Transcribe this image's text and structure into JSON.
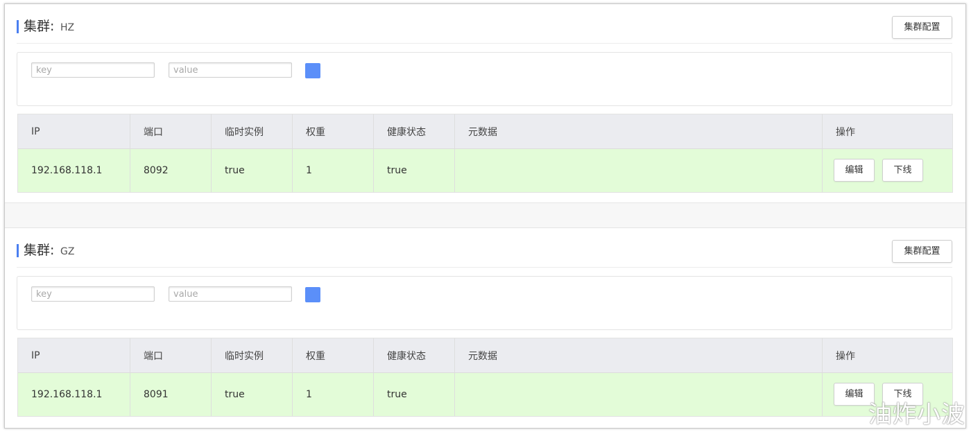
{
  "clusters": [
    {
      "title_label": "集群:",
      "name": "HZ",
      "config_button": "集群配置",
      "filter": {
        "key_placeholder": "key",
        "value_placeholder": "value"
      },
      "columns": [
        "IP",
        "端口",
        "临时实例",
        "权重",
        "健康状态",
        "元数据",
        "操作"
      ],
      "rows": [
        {
          "ip": "192.168.118.1",
          "port": "8092",
          "ephemeral": "true",
          "weight": "1",
          "healthy": "true",
          "metadata": "",
          "edit": "编辑",
          "offline": "下线"
        }
      ]
    },
    {
      "title_label": "集群:",
      "name": "GZ",
      "config_button": "集群配置",
      "filter": {
        "key_placeholder": "key",
        "value_placeholder": "value"
      },
      "columns": [
        "IP",
        "端口",
        "临时实例",
        "权重",
        "健康状态",
        "元数据",
        "操作"
      ],
      "rows": [
        {
          "ip": "192.168.118.1",
          "port": "8091",
          "ephemeral": "true",
          "weight": "1",
          "healthy": "true",
          "metadata": "",
          "edit": "编辑",
          "offline": "下线"
        }
      ]
    }
  ],
  "watermark": "油炸小波",
  "colors": {
    "accent": "#4a7ff0",
    "search_button": "#5b8ff9",
    "row_healthy": "#e3fcd8",
    "header_bg": "#ebecf0"
  }
}
